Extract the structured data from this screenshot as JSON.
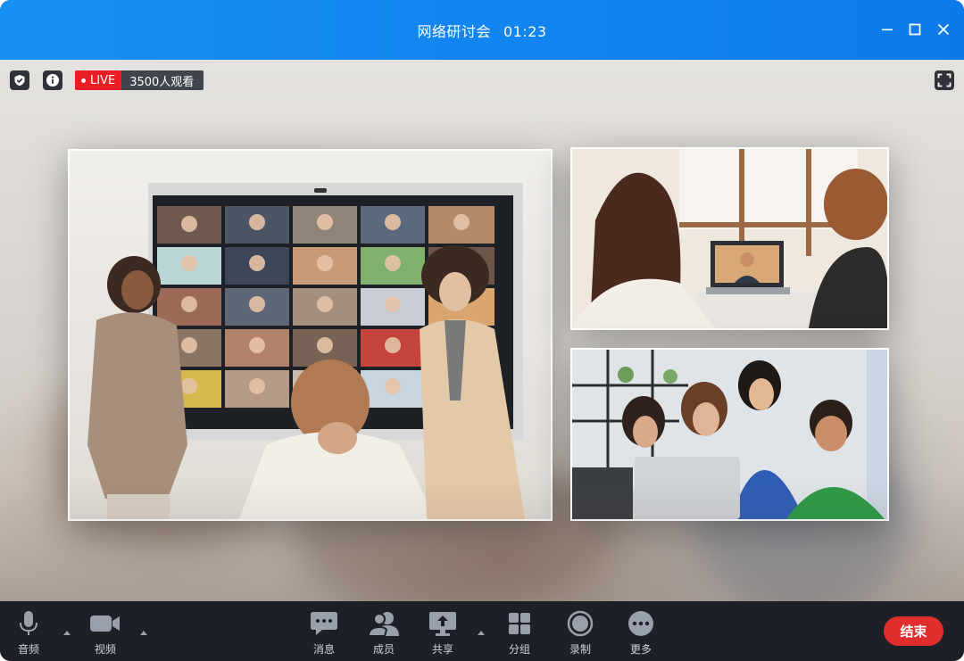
{
  "window": {
    "title": "网络研讨会",
    "timer": "01:23"
  },
  "stage": {
    "live_label": "LIVE",
    "viewers": "3500人观看"
  },
  "toolbar": {
    "audio": "音频",
    "video": "视频",
    "chat": "消息",
    "members": "成员",
    "share": "共享",
    "breakout": "分组",
    "record": "录制",
    "more": "更多",
    "end": "结束"
  },
  "icons": {
    "shield": "shield-icon",
    "info": "info-icon",
    "fullscreen": "fullscreen-icon",
    "microphone": "microphone-icon",
    "camera": "camera-icon",
    "chat": "chat-icon",
    "members": "members-icon",
    "share": "share-icon",
    "breakout": "grid-icon",
    "record": "record-icon",
    "more": "more-icon"
  },
  "colors": {
    "titlebar": "#0c7bea",
    "live": "#ea1c24",
    "end_button": "#e02e2e",
    "toolbar": "#1e2027"
  }
}
